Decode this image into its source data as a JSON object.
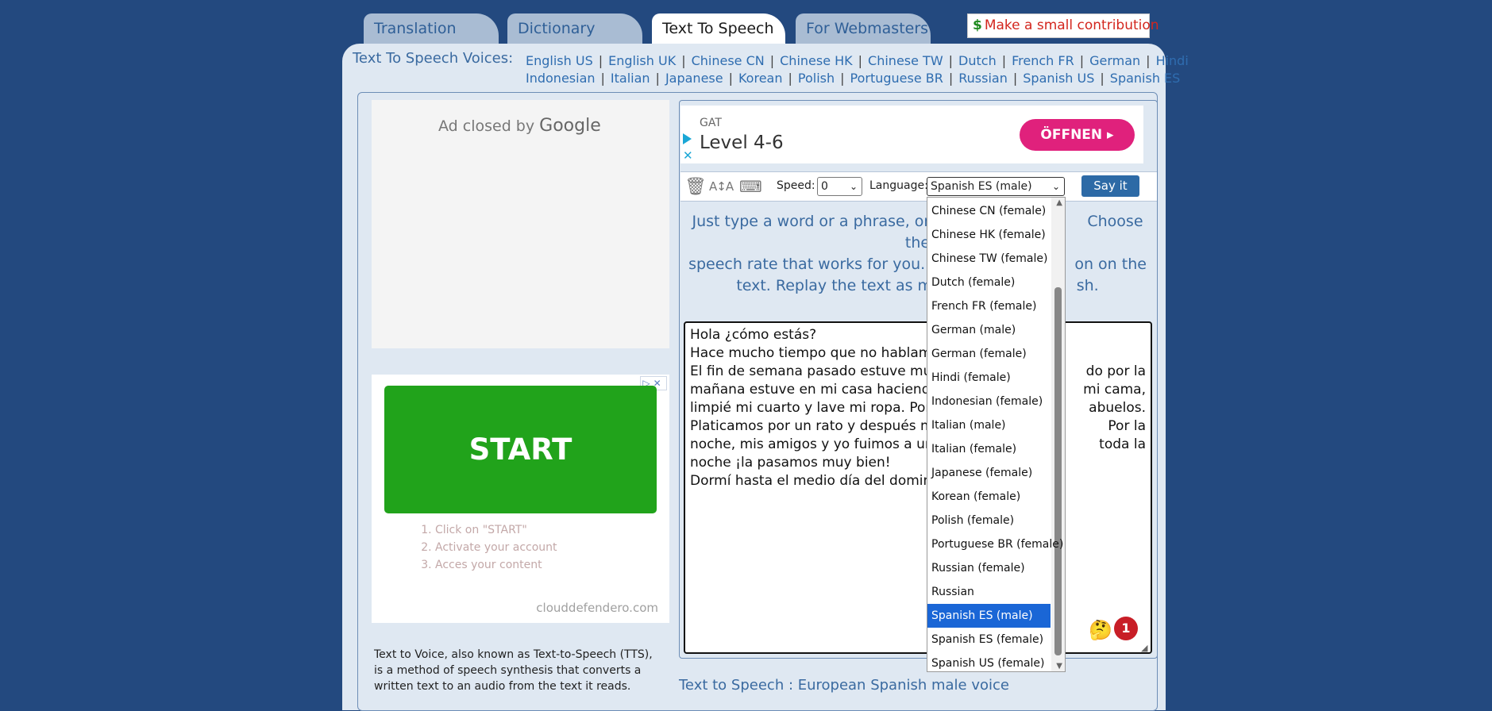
{
  "tabs": [
    {
      "label": "Translation",
      "active": false
    },
    {
      "label": "Dictionary",
      "active": false
    },
    {
      "label": "Text To Speech",
      "active": true
    },
    {
      "label": "For Webmasters",
      "active": false
    }
  ],
  "contribution": {
    "icon": "$",
    "label": "Make a small contribution"
  },
  "voices": {
    "title": "Text To Speech Voices:",
    "row1": [
      "English US",
      "English UK",
      "Chinese CN",
      "Chinese HK",
      "Chinese TW",
      "Dutch",
      "French FR",
      "German",
      "Hindi"
    ],
    "row2": [
      "Indonesian",
      "Italian",
      "Japanese",
      "Korean",
      "Polish",
      "Portuguese BR",
      "Russian",
      "Spanish US",
      "Spanish ES"
    ]
  },
  "left_ads": {
    "closed_text": "Ad closed by",
    "closed_brand": "Google",
    "start_button": "START",
    "steps": [
      "Click on \"START\"",
      "Activate your account",
      "Acces your content"
    ],
    "domain": "clouddefendero.com"
  },
  "tts_description": "Text to Voice, also known as Text-to-Speech (TTS), is a method of speech synthesis that converts a written text to an audio from the text it reads.",
  "top_ad": {
    "sponsor": "GAT",
    "headline": "Level 4-6",
    "cta": "ÖFFNEN ▸"
  },
  "toolbar": {
    "speed_label": "Speed:",
    "speed_value": "0",
    "language_label": "Language:",
    "language_value": "Spanish ES (male)",
    "say_button": "Say it"
  },
  "instructions": {
    "line1": "Just type a word or a phrase, or co",
    "line1b": "Choose the",
    "line2": "speech rate that works for you. S",
    "line2b": "on on the",
    "line3": "text. Replay the text as ma",
    "line3b": "sh."
  },
  "textarea_lines": [
    {
      "left": "Hola ¿cómo estás?",
      "right": ""
    },
    {
      "left": "Hace mucho tiempo que no hablamo",
      "right": ""
    },
    {
      "left": "El fin de semana pasado estuve muy",
      "right": "do por la"
    },
    {
      "left": "mañana estuve en mi casa haciendo",
      "right": "mi cama,"
    },
    {
      "left": "limpié mi cuarto y lave mi ropa. Por",
      "right": "abuelos."
    },
    {
      "left": "Platicamos por un rato y después me",
      "right": "Por la"
    },
    {
      "left": "noche, mis amigos y yo fuimos a una",
      "right": "toda la"
    },
    {
      "left": "noche ¡la pasamos muy bien!",
      "right": ""
    },
    {
      "left": "Dormí hasta el medio día del doming",
      "right": ""
    }
  ],
  "notification_count": "1",
  "footer_voice": "Text to Speech : European Spanish male voice",
  "language_options": [
    "Chinese CN (female)",
    "Chinese HK (female)",
    "Chinese TW (female)",
    "Dutch (female)",
    "French FR (female)",
    "German (male)",
    "German (female)",
    "Hindi (female)",
    "Indonesian (female)",
    "Italian (male)",
    "Italian (female)",
    "Japanese (female)",
    "Korean (female)",
    "Polish (female)",
    "Portuguese BR (female)",
    "Russian (female)",
    "Russian",
    "Spanish ES (male)",
    "Spanish ES (female)",
    "Spanish US (female)"
  ],
  "selected_option": "Spanish ES (male)",
  "colors": {
    "background": "#23497f",
    "panel": "#dfe8f2",
    "link": "#2f6db0",
    "start_green": "#21a31b",
    "cta_pink": "#e0217c",
    "selected_blue": "#1a66d6"
  }
}
